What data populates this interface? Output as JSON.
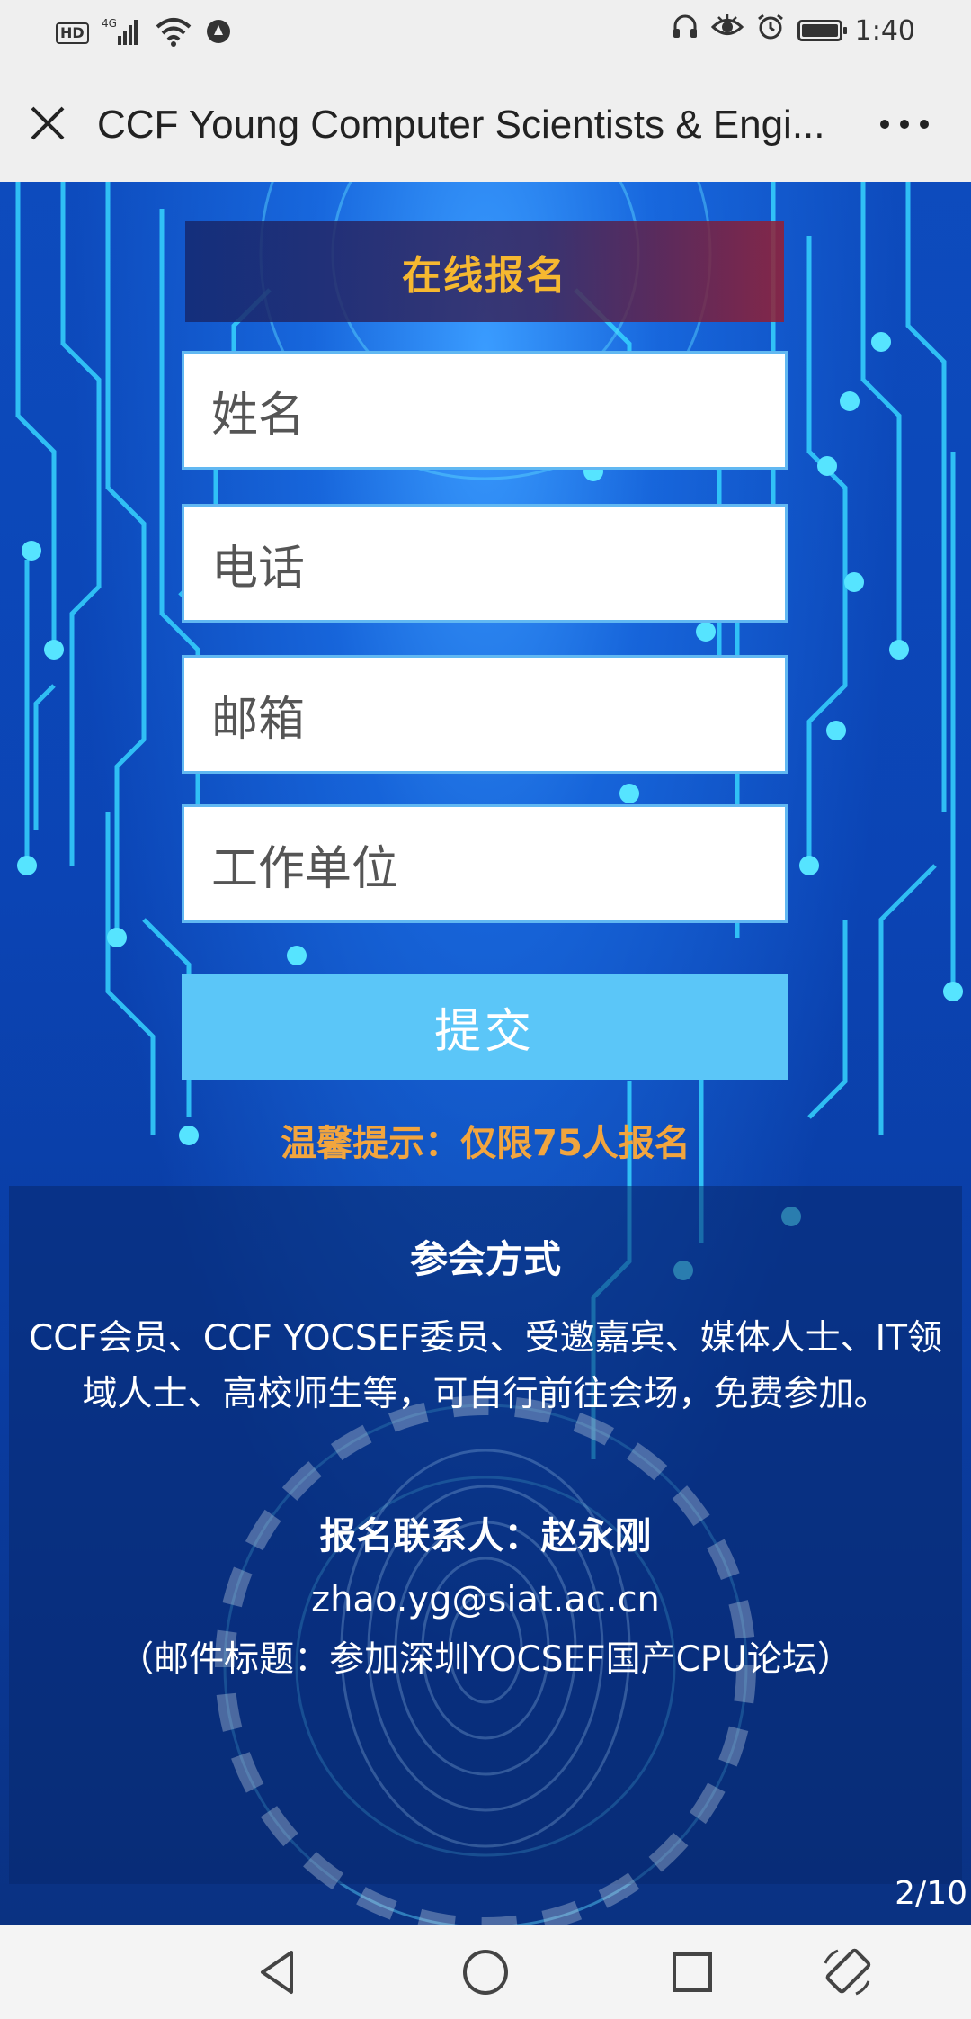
{
  "status_bar": {
    "hd": "HD",
    "network": "4G",
    "time": "1:40",
    "icons_left": [
      "hd-icon",
      "signal-icon",
      "wifi-icon",
      "data-saver-icon"
    ],
    "icons_right": [
      "headphones-icon",
      "eye-icon",
      "alarm-icon",
      "battery-icon"
    ]
  },
  "title_bar": {
    "title": "CCF Young Computer Scientists & Engi...",
    "close_icon": "close-icon",
    "more_icon": "more-icon"
  },
  "form": {
    "heading": "在线报名",
    "fields": [
      {
        "placeholder": "姓名"
      },
      {
        "placeholder": "电话"
      },
      {
        "placeholder": "邮箱"
      },
      {
        "placeholder": "工作单位"
      }
    ],
    "submit_label": "提交",
    "tip": "温馨提示：仅限75人报名"
  },
  "info": {
    "attend_title": "参会方式",
    "attend_desc": "CCF会员、CCF YOCSEF委员、受邀嘉宾、媒体人士、IT领域人士、高校师生等，可自行前往会场，免费参加。",
    "contact_title": "报名联系人：赵永刚",
    "contact_email": "zhao.yg@siat.ac.cn",
    "contact_note": "（邮件标题：参加深圳YOCSEF国产CPU论坛）"
  },
  "page_indicator": "2/10",
  "nav_bar": {
    "buttons": [
      "back-icon",
      "home-icon",
      "recents-icon",
      "rotate-icon"
    ]
  },
  "colors": {
    "accent_title": "#f6b830",
    "tip": "#f2a53e",
    "submit_bg": "#5bc6f8",
    "field_border": "#61b8f2"
  }
}
